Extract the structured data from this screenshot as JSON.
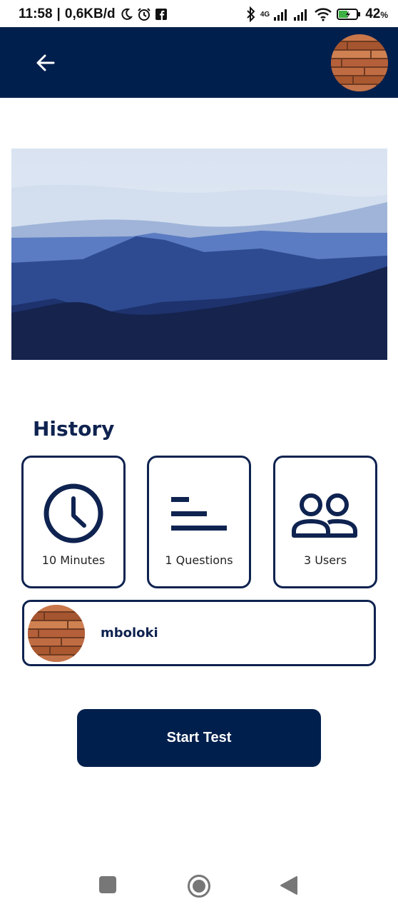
{
  "status_bar": {
    "time": "11:58",
    "speed": "0,6KB/d",
    "network": "4G",
    "battery": "42",
    "battery_unit": "%"
  },
  "colors": {
    "primary": "#001f4d",
    "accent": "#0f2350"
  },
  "header": {
    "back_icon": "arrow-left-icon",
    "avatar_icon": "profile-avatar"
  },
  "history": {
    "title": "History",
    "stats": [
      {
        "icon": "clock-icon",
        "label": "10 Minutes"
      },
      {
        "icon": "bars-icon",
        "label": "1 Questions"
      },
      {
        "icon": "users-icon",
        "label": "3 Users"
      }
    ]
  },
  "user": {
    "name": "mboloki"
  },
  "actions": {
    "start_label": "Start Test"
  },
  "nav": {
    "icons": [
      "square-icon",
      "home-circle-icon",
      "back-triangle-icon"
    ]
  }
}
